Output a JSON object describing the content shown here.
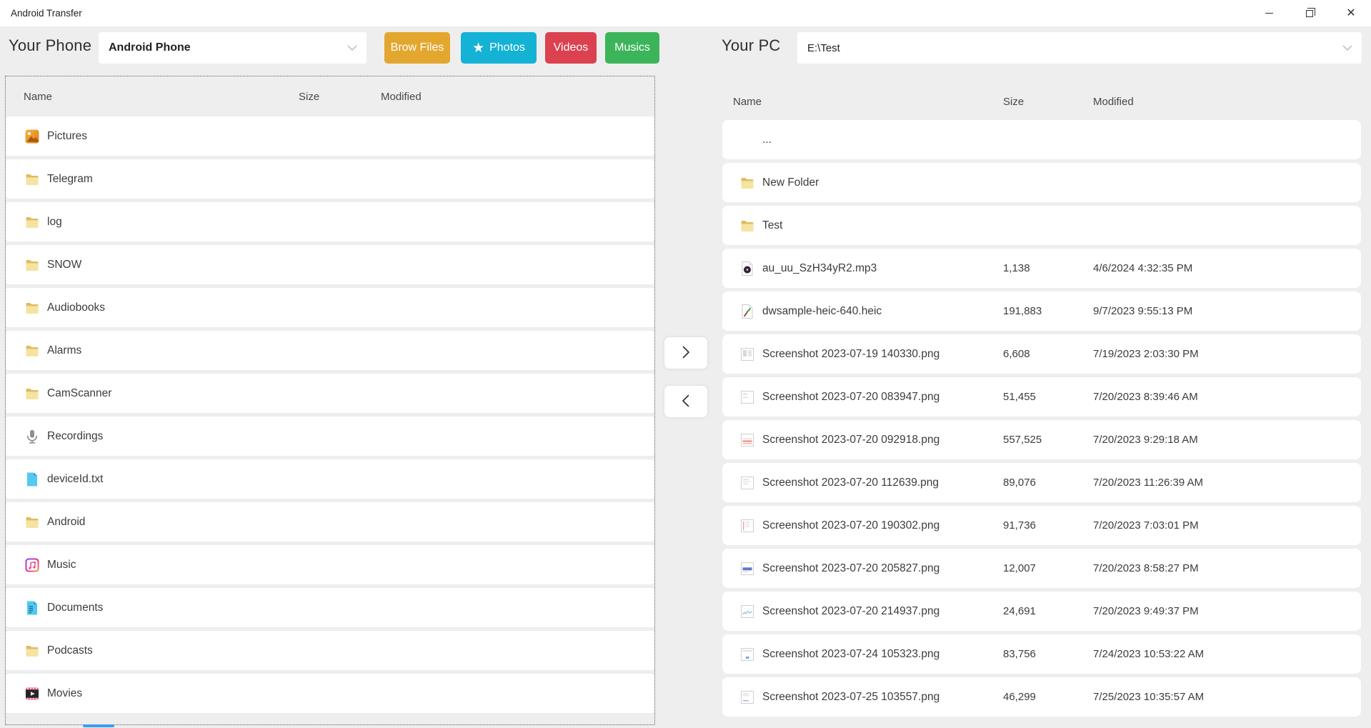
{
  "window": {
    "title": "Android Transfer",
    "controls": {
      "minimize_icon": "minimize-icon",
      "restore_icon": "restore-icon",
      "close_icon": "close-icon",
      "close_glyph": "✕"
    }
  },
  "toolbar": {
    "phone_label": "Your Phone",
    "phone_device": "Android Phone",
    "pc_label": "Your PC",
    "pc_path": "E:\\Test",
    "buttons": [
      {
        "label": "Brow Files",
        "color": "#E3A72F"
      },
      {
        "label": "Photos",
        "color": "#14B2D5",
        "icon_glyph": "★",
        "icon_name": "star-icon"
      },
      {
        "label": "Videos",
        "color": "#DC4150"
      },
      {
        "label": "Musics",
        "color": "#3CB45A"
      }
    ]
  },
  "left_panel": {
    "columns": [
      "Name",
      "Size",
      "Modified"
    ],
    "rows": [
      {
        "name": "Pictures",
        "icon": "gallery",
        "size": "",
        "modified": ""
      },
      {
        "name": "Telegram",
        "icon": "folder",
        "size": "",
        "modified": ""
      },
      {
        "name": "log",
        "icon": "folder",
        "size": "",
        "modified": ""
      },
      {
        "name": "SNOW",
        "icon": "folder",
        "size": "",
        "modified": ""
      },
      {
        "name": "Audiobooks",
        "icon": "folder",
        "size": "",
        "modified": ""
      },
      {
        "name": "Alarms",
        "icon": "folder",
        "size": "",
        "modified": ""
      },
      {
        "name": "CamScanner",
        "icon": "folder",
        "size": "",
        "modified": ""
      },
      {
        "name": "Recordings",
        "icon": "mic",
        "size": "",
        "modified": ""
      },
      {
        "name": "deviceId.txt",
        "icon": "txt",
        "size": "",
        "modified": ""
      },
      {
        "name": "Android",
        "icon": "folder",
        "size": "",
        "modified": ""
      },
      {
        "name": "Music",
        "icon": "musicapp",
        "size": "",
        "modified": ""
      },
      {
        "name": "Documents",
        "icon": "docfile",
        "size": "",
        "modified": ""
      },
      {
        "name": "Podcasts",
        "icon": "folder",
        "size": "",
        "modified": ""
      },
      {
        "name": "Movies",
        "icon": "movie",
        "size": "",
        "modified": ""
      }
    ]
  },
  "transfer": {
    "to_pc_icon": "arrow-right-icon",
    "to_phone_icon": "arrow-left-icon"
  },
  "right_panel": {
    "columns": [
      "Name",
      "Size",
      "Modified"
    ],
    "rows": [
      {
        "name": "...",
        "icon": "none",
        "size": "",
        "modified": ""
      },
      {
        "name": "New Folder",
        "icon": "folder",
        "size": "",
        "modified": ""
      },
      {
        "name": "Test",
        "icon": "folder",
        "size": "",
        "modified": ""
      },
      {
        "name": "au_uu_SzH34yR2.mp3",
        "icon": "audio",
        "size": "1,138",
        "modified": "4/6/2024 4:32:35 PM"
      },
      {
        "name": "dwsample-heic-640.heic",
        "icon": "heic",
        "size": "191,883",
        "modified": "9/7/2023 9:55:13 PM"
      },
      {
        "name": "Screenshot 2023-07-19 140330.png",
        "icon": "thumb1",
        "size": "6,608",
        "modified": "7/19/2023 2:03:30 PM"
      },
      {
        "name": "Screenshot 2023-07-20 083947.png",
        "icon": "thumb2",
        "size": "51,455",
        "modified": "7/20/2023 8:39:46 AM"
      },
      {
        "name": "Screenshot 2023-07-20 092918.png",
        "icon": "thumb3",
        "size": "557,525",
        "modified": "7/20/2023 9:29:18 AM"
      },
      {
        "name": "Screenshot 2023-07-20 112639.png",
        "icon": "thumb4",
        "size": "89,076",
        "modified": "7/20/2023 11:26:39 AM"
      },
      {
        "name": "Screenshot 2023-07-20 190302.png",
        "icon": "thumb5",
        "size": "91,736",
        "modified": "7/20/2023 7:03:01 PM"
      },
      {
        "name": "Screenshot 2023-07-20 205827.png",
        "icon": "thumb6",
        "size": "12,007",
        "modified": "7/20/2023 8:58:27 PM"
      },
      {
        "name": "Screenshot 2023-07-20 214937.png",
        "icon": "thumb7",
        "size": "24,691",
        "modified": "7/20/2023 9:49:37 PM"
      },
      {
        "name": "Screenshot 2023-07-24 105323.png",
        "icon": "thumb8",
        "size": "83,756",
        "modified": "7/24/2023 10:53:22 AM"
      },
      {
        "name": "Screenshot 2023-07-25 103557.png",
        "icon": "thumb9",
        "size": "46,299",
        "modified": "7/25/2023 10:35:57 AM"
      }
    ]
  },
  "misc": {
    "scrollbar_color": "#3E9BF4"
  }
}
